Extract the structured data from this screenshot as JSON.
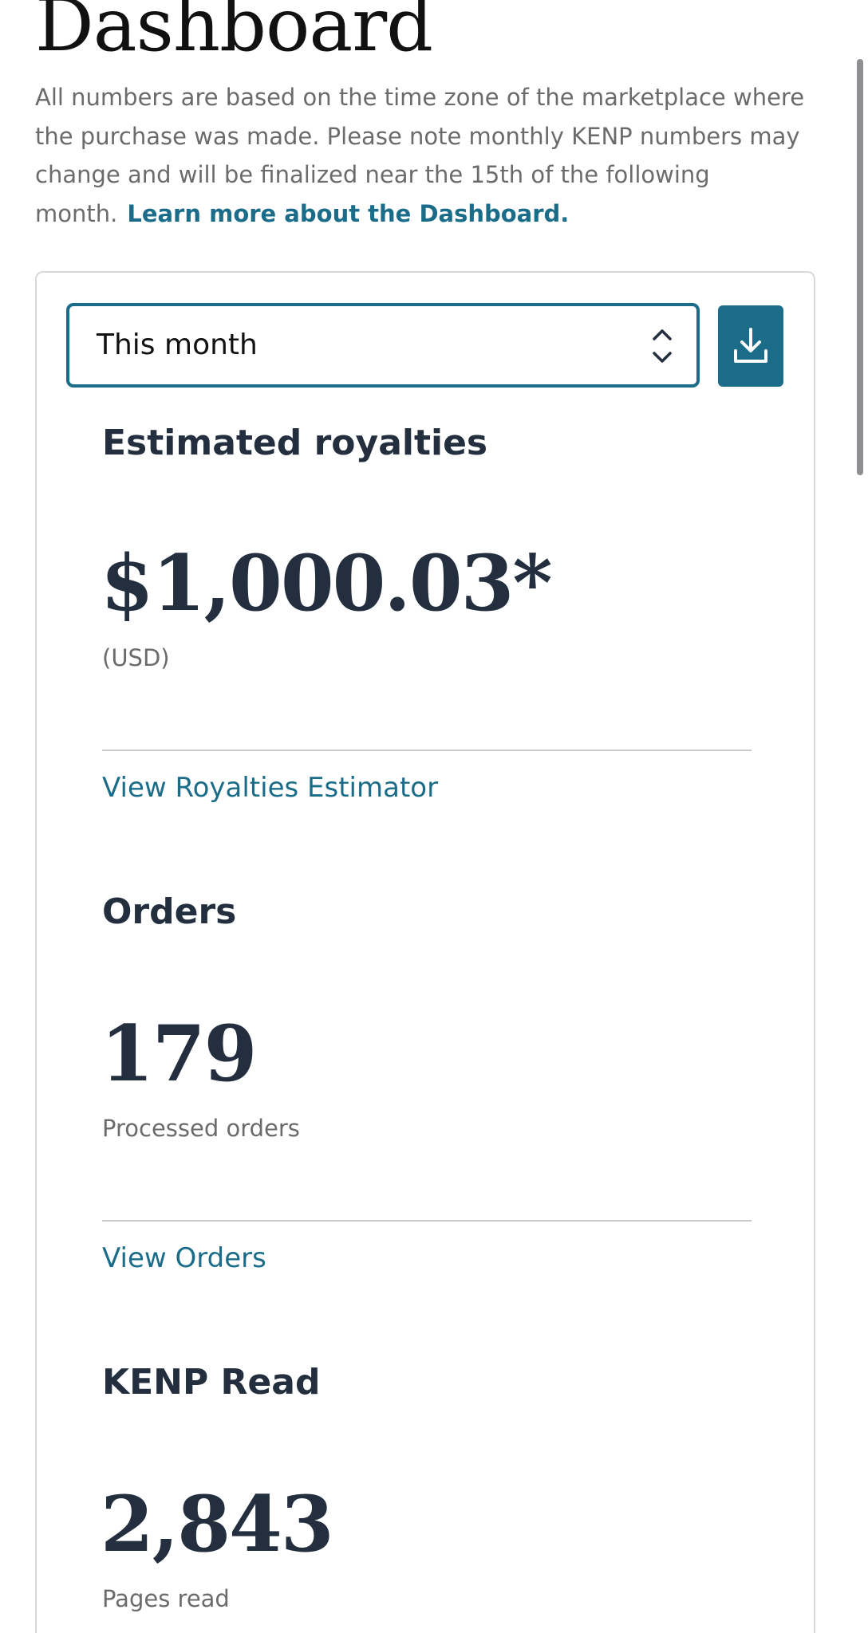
{
  "page": {
    "title": "Dashboard",
    "intro_text": "All numbers are based on the time zone of the marketplace where the purchase was made. Please note monthly KENP numbers may change and will be finalized near the 15th of the following month.",
    "learn_more_link": "Learn more about the Dashboard."
  },
  "filter": {
    "selected_period": "This month",
    "chevrons_icon": "chevron-up-down-icon",
    "download_icon": "download-icon"
  },
  "royalties": {
    "heading": "Estimated royalties",
    "amount": "$1,000.03*",
    "currency": "(USD)",
    "link": "View Royalties Estimator"
  },
  "orders": {
    "heading": "Orders",
    "count": "179",
    "label": "Processed orders",
    "link": "View Orders"
  },
  "kenp": {
    "heading": "KENP Read",
    "count": "2,843",
    "label": "Pages read"
  },
  "colors": {
    "accent": "#1b6c88",
    "heading": "#232f3e",
    "muted_text": "#6b6b6b",
    "border": "#d5d9d9"
  }
}
